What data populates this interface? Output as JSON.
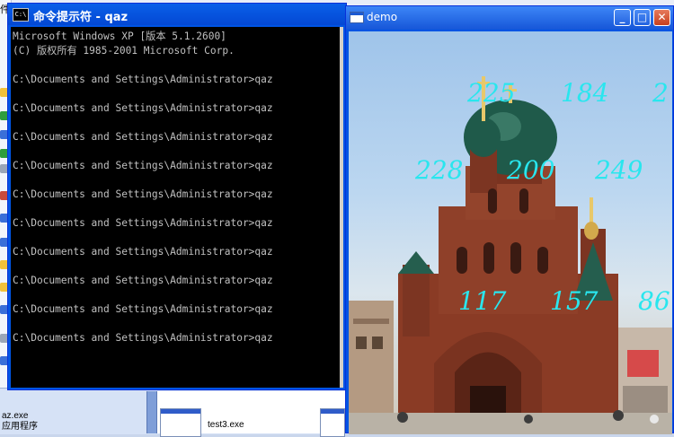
{
  "desktop": {
    "left_strip_text": [
      "件",
      "az.exe",
      "应用程序"
    ],
    "file_left_line1": "az.exe",
    "file_left_line2": "应用程序",
    "file_label": "test3.exe"
  },
  "cmd": {
    "icon_label": "C:\\",
    "title": "命令提示符 - qaz",
    "lines": [
      "Microsoft Windows XP [版本 5.1.2600]",
      "(C) 版权所有 1985-2001 Microsoft Corp.",
      "",
      "C:\\Documents and Settings\\Administrator>qaz",
      "",
      "C:\\Documents and Settings\\Administrator>qaz",
      "",
      "C:\\Documents and Settings\\Administrator>qaz",
      "",
      "C:\\Documents and Settings\\Administrator>qaz",
      "",
      "C:\\Documents and Settings\\Administrator>qaz",
      "",
      "C:\\Documents and Settings\\Administrator>qaz",
      "",
      "C:\\Documents and Settings\\Administrator>qaz",
      "",
      "C:\\Documents and Settings\\Administrator>qaz",
      "",
      "C:\\Documents and Settings\\Administrator>qaz",
      "",
      "C:\\Documents and Settings\\Administrator>qaz"
    ]
  },
  "demo": {
    "title": "demo",
    "buttons": {
      "minimize": "_",
      "maximize": "□",
      "close": "✕"
    },
    "image_subject": "cathedral-photo",
    "overlay_color": "#29e6ee",
    "values": {
      "row1": [
        "225",
        "184",
        "2"
      ],
      "row2": [
        "228",
        "200",
        "249"
      ],
      "row3": [
        "117",
        "157",
        "86"
      ]
    }
  }
}
